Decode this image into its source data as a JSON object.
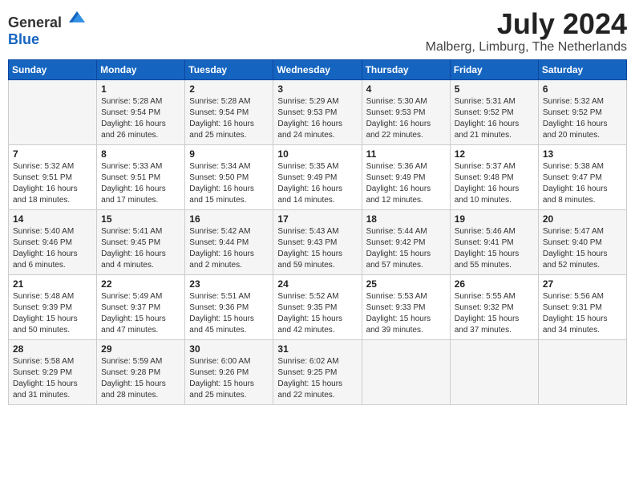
{
  "header": {
    "logo": {
      "general": "General",
      "blue": "Blue"
    },
    "title": "July 2024",
    "location": "Malberg, Limburg, The Netherlands"
  },
  "calendar": {
    "days_of_week": [
      "Sunday",
      "Monday",
      "Tuesday",
      "Wednesday",
      "Thursday",
      "Friday",
      "Saturday"
    ],
    "weeks": [
      [
        {
          "day": "",
          "details": ""
        },
        {
          "day": "1",
          "details": "Sunrise: 5:28 AM\nSunset: 9:54 PM\nDaylight: 16 hours\nand 26 minutes."
        },
        {
          "day": "2",
          "details": "Sunrise: 5:28 AM\nSunset: 9:54 PM\nDaylight: 16 hours\nand 25 minutes."
        },
        {
          "day": "3",
          "details": "Sunrise: 5:29 AM\nSunset: 9:53 PM\nDaylight: 16 hours\nand 24 minutes."
        },
        {
          "day": "4",
          "details": "Sunrise: 5:30 AM\nSunset: 9:53 PM\nDaylight: 16 hours\nand 22 minutes."
        },
        {
          "day": "5",
          "details": "Sunrise: 5:31 AM\nSunset: 9:52 PM\nDaylight: 16 hours\nand 21 minutes."
        },
        {
          "day": "6",
          "details": "Sunrise: 5:32 AM\nSunset: 9:52 PM\nDaylight: 16 hours\nand 20 minutes."
        }
      ],
      [
        {
          "day": "7",
          "details": "Sunrise: 5:32 AM\nSunset: 9:51 PM\nDaylight: 16 hours\nand 18 minutes."
        },
        {
          "day": "8",
          "details": "Sunrise: 5:33 AM\nSunset: 9:51 PM\nDaylight: 16 hours\nand 17 minutes."
        },
        {
          "day": "9",
          "details": "Sunrise: 5:34 AM\nSunset: 9:50 PM\nDaylight: 16 hours\nand 15 minutes."
        },
        {
          "day": "10",
          "details": "Sunrise: 5:35 AM\nSunset: 9:49 PM\nDaylight: 16 hours\nand 14 minutes."
        },
        {
          "day": "11",
          "details": "Sunrise: 5:36 AM\nSunset: 9:49 PM\nDaylight: 16 hours\nand 12 minutes."
        },
        {
          "day": "12",
          "details": "Sunrise: 5:37 AM\nSunset: 9:48 PM\nDaylight: 16 hours\nand 10 minutes."
        },
        {
          "day": "13",
          "details": "Sunrise: 5:38 AM\nSunset: 9:47 PM\nDaylight: 16 hours\nand 8 minutes."
        }
      ],
      [
        {
          "day": "14",
          "details": "Sunrise: 5:40 AM\nSunset: 9:46 PM\nDaylight: 16 hours\nand 6 minutes."
        },
        {
          "day": "15",
          "details": "Sunrise: 5:41 AM\nSunset: 9:45 PM\nDaylight: 16 hours\nand 4 minutes."
        },
        {
          "day": "16",
          "details": "Sunrise: 5:42 AM\nSunset: 9:44 PM\nDaylight: 16 hours\nand 2 minutes."
        },
        {
          "day": "17",
          "details": "Sunrise: 5:43 AM\nSunset: 9:43 PM\nDaylight: 15 hours\nand 59 minutes."
        },
        {
          "day": "18",
          "details": "Sunrise: 5:44 AM\nSunset: 9:42 PM\nDaylight: 15 hours\nand 57 minutes."
        },
        {
          "day": "19",
          "details": "Sunrise: 5:46 AM\nSunset: 9:41 PM\nDaylight: 15 hours\nand 55 minutes."
        },
        {
          "day": "20",
          "details": "Sunrise: 5:47 AM\nSunset: 9:40 PM\nDaylight: 15 hours\nand 52 minutes."
        }
      ],
      [
        {
          "day": "21",
          "details": "Sunrise: 5:48 AM\nSunset: 9:39 PM\nDaylight: 15 hours\nand 50 minutes."
        },
        {
          "day": "22",
          "details": "Sunrise: 5:49 AM\nSunset: 9:37 PM\nDaylight: 15 hours\nand 47 minutes."
        },
        {
          "day": "23",
          "details": "Sunrise: 5:51 AM\nSunset: 9:36 PM\nDaylight: 15 hours\nand 45 minutes."
        },
        {
          "day": "24",
          "details": "Sunrise: 5:52 AM\nSunset: 9:35 PM\nDaylight: 15 hours\nand 42 minutes."
        },
        {
          "day": "25",
          "details": "Sunrise: 5:53 AM\nSunset: 9:33 PM\nDaylight: 15 hours\nand 39 minutes."
        },
        {
          "day": "26",
          "details": "Sunrise: 5:55 AM\nSunset: 9:32 PM\nDaylight: 15 hours\nand 37 minutes."
        },
        {
          "day": "27",
          "details": "Sunrise: 5:56 AM\nSunset: 9:31 PM\nDaylight: 15 hours\nand 34 minutes."
        }
      ],
      [
        {
          "day": "28",
          "details": "Sunrise: 5:58 AM\nSunset: 9:29 PM\nDaylight: 15 hours\nand 31 minutes."
        },
        {
          "day": "29",
          "details": "Sunrise: 5:59 AM\nSunset: 9:28 PM\nDaylight: 15 hours\nand 28 minutes."
        },
        {
          "day": "30",
          "details": "Sunrise: 6:00 AM\nSunset: 9:26 PM\nDaylight: 15 hours\nand 25 minutes."
        },
        {
          "day": "31",
          "details": "Sunrise: 6:02 AM\nSunset: 9:25 PM\nDaylight: 15 hours\nand 22 minutes."
        },
        {
          "day": "",
          "details": ""
        },
        {
          "day": "",
          "details": ""
        },
        {
          "day": "",
          "details": ""
        }
      ]
    ]
  }
}
